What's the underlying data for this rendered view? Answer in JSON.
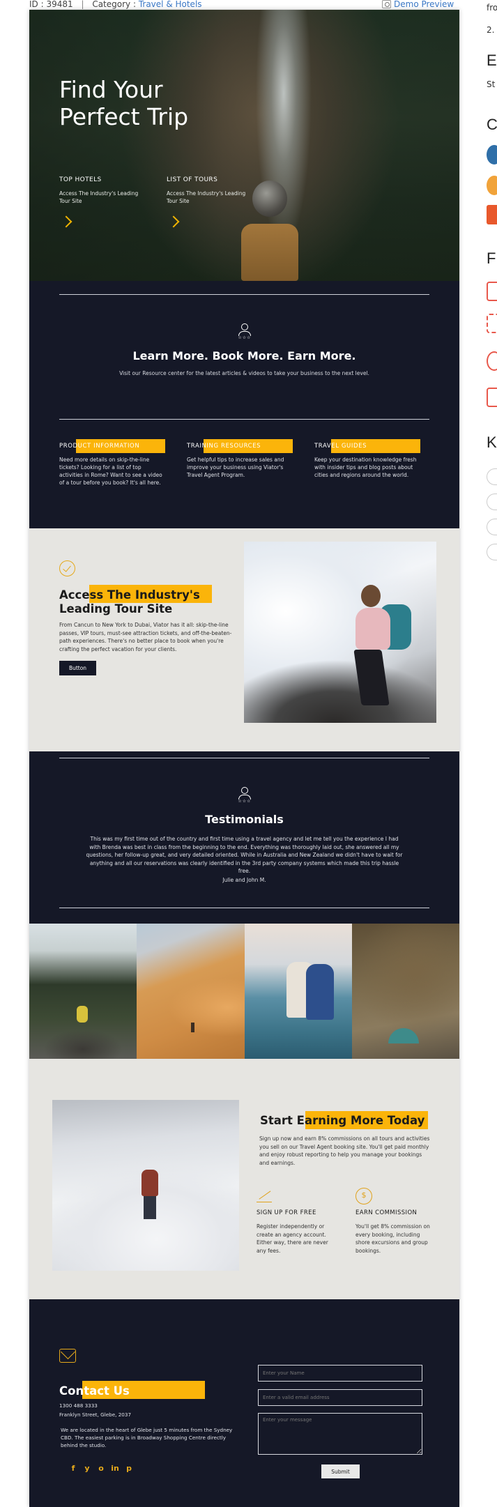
{
  "meta": {
    "id_text": "ID : 39481",
    "category_label": "Category :",
    "category_value": "Travel & Hotels",
    "demo_preview": "Demo Preview"
  },
  "sidebar": {
    "line1": "fro",
    "line2": "2.",
    "head_e": "E",
    "line3": "St",
    "head_c": "C",
    "head_f": "F",
    "head_k": "K"
  },
  "hero": {
    "title_line1": "Find Your",
    "title_line2": "Perfect Trip",
    "columns": [
      {
        "heading": "TOP HOTELS",
        "desc": "Access The Industry's Leading Tour Site"
      },
      {
        "heading": "LIST OF TOURS",
        "desc": "Access The Industry's Leading Tour Site"
      }
    ]
  },
  "learn": {
    "title": "Learn More. Book More. Earn More.",
    "subtitle": "Visit our Resource center for the latest articles & videos to take your business to the next level.",
    "features": [
      {
        "heading": "PRODUCT INFORMATION",
        "desc": "Need more details on skip-the-line tickets? Looking for a list of top activities in Rome? Want to see a video of a tour before you book? It's all here."
      },
      {
        "heading": "TRAINING RESOURCES",
        "desc": "Get helpful tips to increase sales and improve your business using Viator's Travel Agent Program."
      },
      {
        "heading": "TRAVEL GUIDES",
        "desc": "Keep your destination knowledge fresh with insider tips and blog posts about cities and regions around the world."
      }
    ]
  },
  "access": {
    "title_line1": "Access The Industry's",
    "title_line2": "Leading Tour Site",
    "text": "From Cancun to New York to Dubai, Viator has it all: skip-the-line passes, VIP tours, must-see attraction tickets, and off-the-beaten-path experiences. There's no better place to book when you're crafting the perfect vacation for your clients.",
    "button_label": "Button"
  },
  "testimonials": {
    "title": "Testimonials",
    "quote": "This was my first time out of the country and first time using a travel agency and let me tell you the experience I had with Brenda was best in class from the beginning to the end. Everything was thoroughly laid out, she answered all my questions, her follow-up great, and very detailed oriented. While in Australia and New Zealand we didn't have to wait for anything and all our reservations was clearly identified in the 3rd party company systems which made this trip hassle free.",
    "author": "Julie and John M."
  },
  "earn": {
    "title": "Start Earning More Today",
    "text": "Sign up now and earn 8% commissions on all tours and activities you sell on our Travel Agent booking site. You'll get paid monthly and enjoy robust reporting to help you manage your bookings and earnings.",
    "columns": [
      {
        "heading": "SIGN UP FOR FREE",
        "desc": "Register independently or create an agency account. Either way, there are never any fees."
      },
      {
        "heading": "EARN COMMISSION",
        "desc": "You'll get 8% commission on every booking, including shore excursions and group bookings."
      }
    ]
  },
  "contact": {
    "title": "Contact Us",
    "phone": "1300 488 3333",
    "address": "Franklyn Street, Glebe, 2037",
    "note": "We are located in the heart of Glebe just 5 minutes from the Sydney CBD. The easiest parking is in Broadway Shopping Centre directly behind the studio.",
    "socials": [
      "f",
      "y",
      "o",
      "in",
      "p"
    ],
    "name_placeholder": "Enter your Name",
    "email_placeholder": "Enter a valid email address",
    "message_placeholder": "Enter your message",
    "submit_label": "Submit"
  },
  "colors": {
    "navy": "#151827",
    "beige": "#e6e5e1",
    "highlight": "#fbb40a",
    "accent_gold": "#e5a91b",
    "link": "#3b78c6"
  }
}
